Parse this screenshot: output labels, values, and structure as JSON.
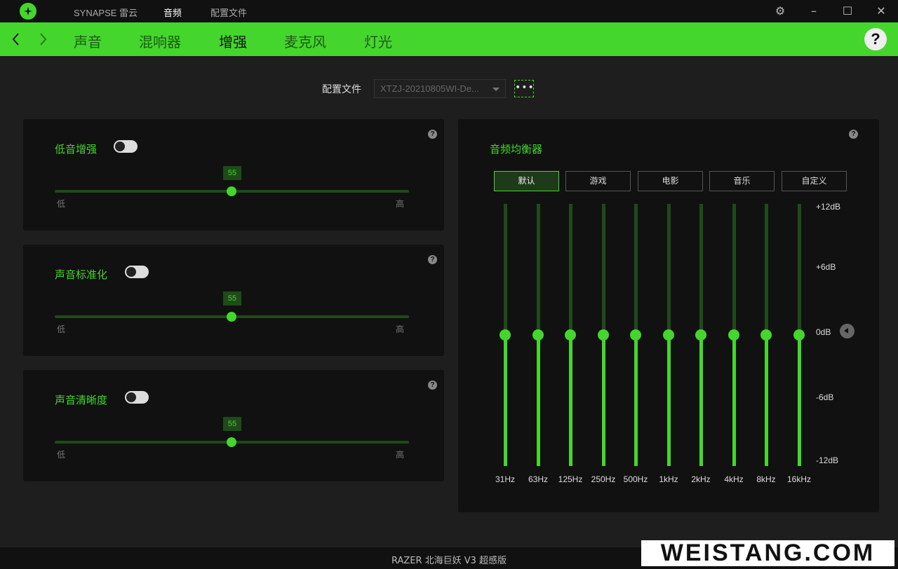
{
  "titlebar": {
    "tabs": [
      "SYNAPSE 雷云",
      "音频",
      "配置文件"
    ],
    "active_tab": 1
  },
  "nav": {
    "tabs": [
      "声音",
      "混响器",
      "增强",
      "麦克风",
      "灯光"
    ],
    "active_tab": 2,
    "help_label": "?"
  },
  "profile": {
    "label": "配置文件",
    "value": "XTZJ-20210805WI-De...",
    "more_label": "•••"
  },
  "enhancements": [
    {
      "title": "低音增强",
      "enabled": false,
      "value": "55",
      "low_label": "低",
      "high_label": "高",
      "level": 0.5
    },
    {
      "title": "声音标准化",
      "enabled": false,
      "value": "55",
      "low_label": "低",
      "high_label": "高",
      "level": 0.5
    },
    {
      "title": "声音清晰度",
      "enabled": false,
      "value": "55",
      "low_label": "低",
      "high_label": "高",
      "level": 0.5
    }
  ],
  "help_glyph": "?",
  "equalizer": {
    "title": "音频均衡器",
    "presets": [
      "默认",
      "游戏",
      "电影",
      "音乐",
      "自定义"
    ],
    "active_preset": 0,
    "db_labels": [
      "+12dB",
      "+6dB",
      "0dB",
      "-6dB",
      "-12dB"
    ],
    "bands": [
      {
        "freq": "31Hz",
        "gain_db": 0
      },
      {
        "freq": "63Hz",
        "gain_db": 0
      },
      {
        "freq": "125Hz",
        "gain_db": 0
      },
      {
        "freq": "250Hz",
        "gain_db": 0
      },
      {
        "freq": "500Hz",
        "gain_db": 0
      },
      {
        "freq": "1kHz",
        "gain_db": 0
      },
      {
        "freq": "2kHz",
        "gain_db": 0
      },
      {
        "freq": "4kHz",
        "gain_db": 0
      },
      {
        "freq": "8kHz",
        "gain_db": 0
      },
      {
        "freq": "16kHz",
        "gain_db": 0
      }
    ]
  },
  "footer": {
    "device_name": "RAZER 北海巨妖 V3 超感版"
  },
  "watermark": "WEISTANG.COM",
  "colors": {
    "accent": "#44d62c",
    "background": "#1e1e1e",
    "panel": "#111111"
  }
}
